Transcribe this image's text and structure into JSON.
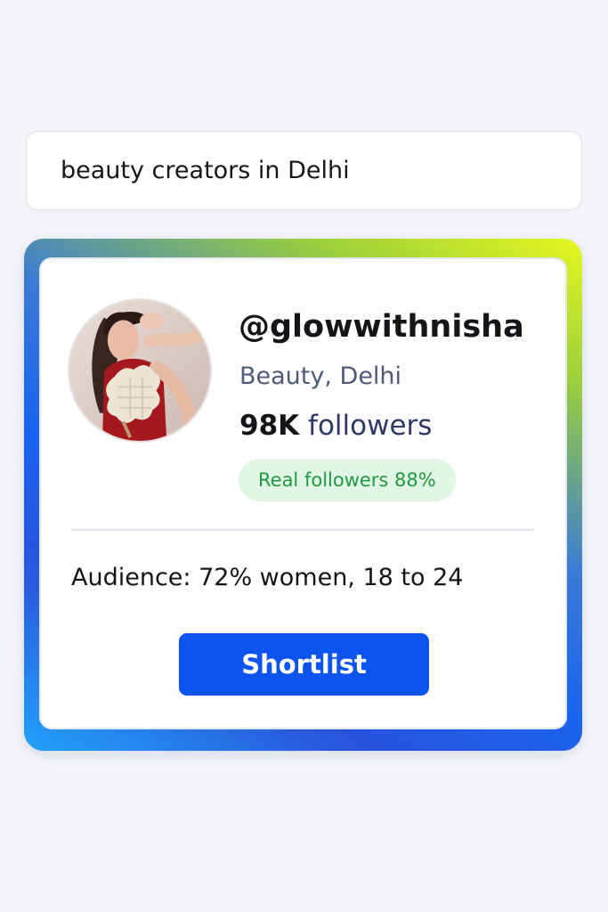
{
  "search": {
    "query": "beauty creators in Delhi"
  },
  "profile": {
    "handle": "@glowwithnisha",
    "niche_location": "Beauty, Delhi",
    "followers_count": "98K",
    "followers_label": "followers",
    "real_followers_badge": "Real followers 88%",
    "audience": "Audience: 72% women, 18 to 24",
    "avatar_icon": "creator-photo"
  },
  "actions": {
    "shortlist_label": "Shortlist"
  },
  "colors": {
    "accent": "#0d54ef",
    "badge_bg": "#e1f6e5",
    "badge_text": "#1f9a42",
    "secondary_text": "#4e5a7a"
  }
}
